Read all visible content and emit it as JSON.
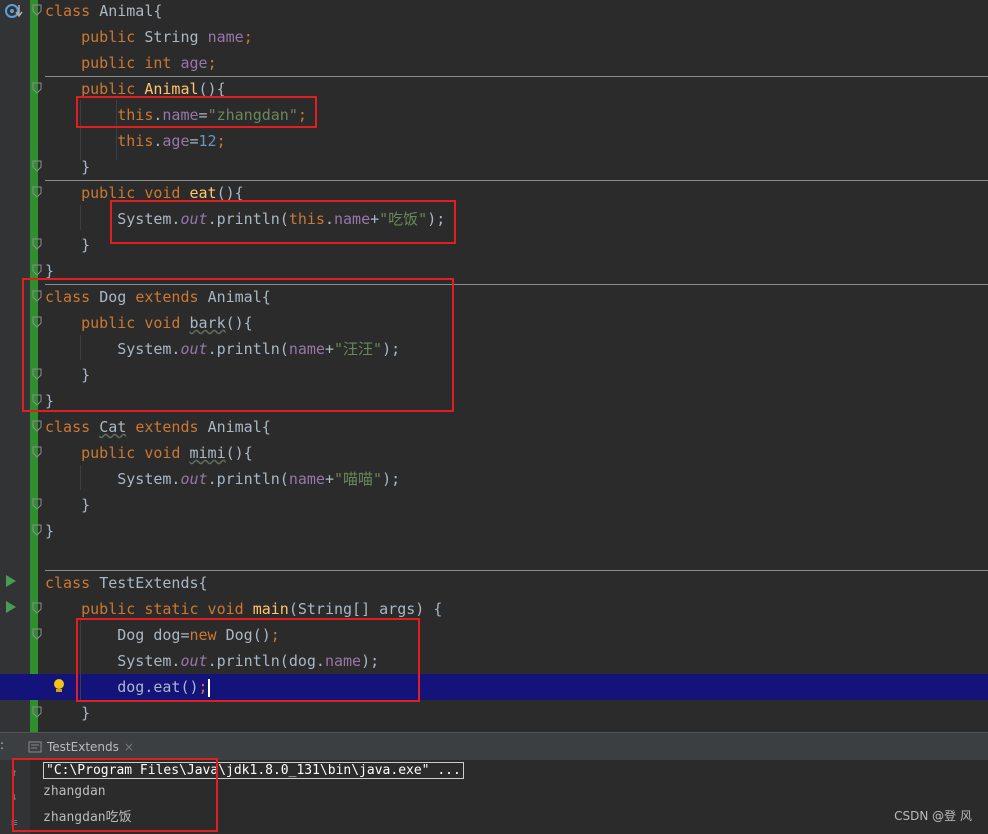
{
  "editor": {
    "lines": [
      [
        [
          "class ",
          "k"
        ],
        [
          "Animal{",
          ""
        ]
      ],
      [
        [
          "    public ",
          "k"
        ],
        [
          "String ",
          ""
        ],
        [
          "name",
          "f"
        ],
        [
          ";",
          "k"
        ]
      ],
      [
        [
          "    public int ",
          "k"
        ],
        [
          "age",
          "f"
        ],
        [
          ";",
          "k"
        ]
      ],
      [
        [
          "    public ",
          "k"
        ],
        [
          "Animal",
          "m"
        ],
        [
          "(){",
          ""
        ]
      ],
      [
        [
          "        this",
          "k"
        ],
        [
          ".",
          ""
        ],
        [
          "name",
          "f"
        ],
        [
          "=",
          ""
        ],
        [
          "\"zhangdan\"",
          "s"
        ],
        [
          ";",
          "k"
        ]
      ],
      [
        [
          "        this",
          "k"
        ],
        [
          ".",
          ""
        ],
        [
          "age",
          "f"
        ],
        [
          "=",
          ""
        ],
        [
          "12",
          "n"
        ],
        [
          ";",
          "k"
        ]
      ],
      [
        [
          "    }",
          ""
        ]
      ],
      [
        [
          "    public void ",
          "k"
        ],
        [
          "eat",
          "m"
        ],
        [
          "(){",
          ""
        ]
      ],
      [
        [
          "        System.",
          ""
        ],
        [
          "out",
          "i"
        ],
        [
          ".println(",
          ""
        ],
        [
          "this",
          "k"
        ],
        [
          ".",
          ""
        ],
        [
          "name",
          "f"
        ],
        [
          "+",
          ""
        ],
        [
          "\"吃饭\"",
          "s"
        ],
        [
          ");",
          ""
        ]
      ],
      [
        [
          "    }",
          ""
        ]
      ],
      [
        [
          "}",
          ""
        ]
      ],
      [
        [
          "class ",
          "k"
        ],
        [
          "Dog ",
          ""
        ],
        [
          "extends ",
          "k"
        ],
        [
          "Animal{",
          ""
        ]
      ],
      [
        [
          "    public void ",
          "k"
        ],
        [
          "bark",
          "u"
        ],
        [
          "(){",
          ""
        ]
      ],
      [
        [
          "        System.",
          ""
        ],
        [
          "out",
          "i"
        ],
        [
          ".println(",
          ""
        ],
        [
          "name",
          "f"
        ],
        [
          "+",
          ""
        ],
        [
          "\"汪汪\"",
          "s"
        ],
        [
          ");",
          ""
        ]
      ],
      [
        [
          "    }",
          ""
        ]
      ],
      [
        [
          "}",
          ""
        ]
      ],
      [
        [
          "class ",
          "k"
        ],
        [
          "Cat",
          "u"
        ],
        [
          " ",
          ""
        ],
        [
          "extends ",
          "k"
        ],
        [
          "Animal{",
          ""
        ]
      ],
      [
        [
          "    public void ",
          "k"
        ],
        [
          "mimi",
          "u"
        ],
        [
          "(){",
          ""
        ]
      ],
      [
        [
          "        System.",
          ""
        ],
        [
          "out",
          "i"
        ],
        [
          ".println(",
          ""
        ],
        [
          "name",
          "f"
        ],
        [
          "+",
          ""
        ],
        [
          "\"喵喵\"",
          "s"
        ],
        [
          ");",
          ""
        ]
      ],
      [
        [
          "    }",
          ""
        ]
      ],
      [
        [
          "}",
          ""
        ]
      ],
      [
        [
          "",
          ""
        ]
      ],
      [
        [
          "class ",
          "k"
        ],
        [
          "TestExtends{",
          ""
        ]
      ],
      [
        [
          "    public static void ",
          "k"
        ],
        [
          "main",
          "m"
        ],
        [
          "(String[] args) {",
          ""
        ]
      ],
      [
        [
          "        Dog dog=",
          ""
        ],
        [
          "new ",
          "k"
        ],
        [
          "Dog()",
          ""
        ],
        [
          ";",
          "k"
        ]
      ],
      [
        [
          "        System.",
          ""
        ],
        [
          "out",
          "i"
        ],
        [
          ".println(dog.",
          ""
        ],
        [
          "name",
          "f"
        ],
        [
          ");",
          ""
        ]
      ],
      [
        [
          "        dog.eat()",
          ""
        ],
        [
          ";",
          "k"
        ]
      ],
      [
        [
          "    }",
          ""
        ]
      ]
    ]
  },
  "colors": {
    "k": "#cc7832",
    "f": "#9876aa",
    "s": "#6a8759",
    "n": "#6897bb",
    "m": "#ffc66d",
    "i": "#9876aa",
    "u": "#a9b7c6",
    "": "#a9b7c6"
  },
  "icons": {
    "gutter_top": "override-icon",
    "run": "run-icon",
    "intention": "lightbulb-icon"
  },
  "run_panel": {
    "tab_label": "TestExtends",
    "output": [
      "\"C:\\Program Files\\Java\\jdk1.8.0_131\\bin\\java.exe\" ...",
      "zhangdan",
      "zhangdan吃饭"
    ]
  },
  "watermark": "CSDN @登 风"
}
